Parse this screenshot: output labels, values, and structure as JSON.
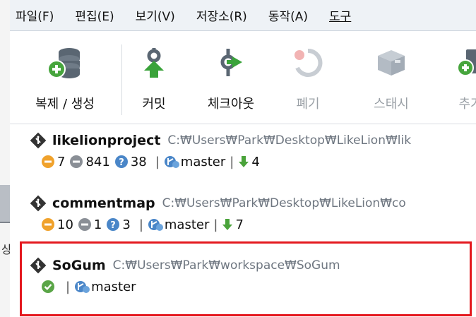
{
  "menu": [
    "파일(F)",
    "편집(E)",
    "보기(V)",
    "저장소(R)",
    "동작(A)",
    "도구"
  ],
  "toolbar": {
    "clone": "복제 / 생성",
    "commit": "커밋",
    "checkout": "체크아웃",
    "discard": "폐기",
    "stash": "스태시",
    "add": "추가"
  },
  "repos": [
    {
      "name": "likelionproject",
      "path": "C:₩Users₩Park₩Desktop₩LikeLion₩lik",
      "modified": "7",
      "removed": "841",
      "untracked": "38",
      "branch": "master",
      "behind": "4"
    },
    {
      "name": "commentmap",
      "path": "C:₩Users₩Park₩Desktop₩LikeLion₩co",
      "modified": "10",
      "removed": "1",
      "untracked": "3",
      "branch": "master",
      "behind": "7"
    },
    {
      "name": "SoGum",
      "path": "C:₩Users₩Park₩workspace₩SoGum",
      "branch": "master"
    }
  ],
  "colors": {
    "highlight": "#e4191f",
    "modified": "#f0a22c",
    "removed": "#8a8f96",
    "untracked": "#4a86c8",
    "behind": "#4aa33a",
    "clean": "#5aa547"
  }
}
